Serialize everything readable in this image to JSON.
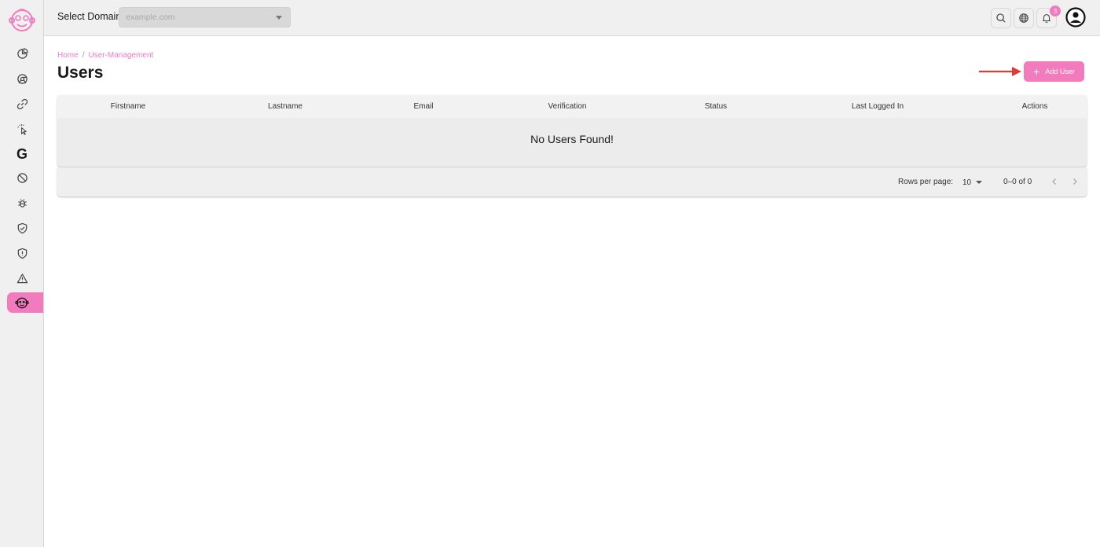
{
  "header": {
    "domain_label": "Select Domain",
    "domain_value": "example.com",
    "notification_count": "3"
  },
  "breadcrumb": {
    "home": "Home",
    "separator": "/",
    "current": "User-Management"
  },
  "page": {
    "title": "Users",
    "add_button_label": "Add User"
  },
  "table": {
    "columns": [
      "Firstname",
      "Lastname",
      "Email",
      "Verification",
      "Status",
      "Last Logged In",
      "Actions"
    ],
    "empty_message": "No Users Found!"
  },
  "pagination": {
    "rows_per_page_label": "Rows per page:",
    "rows_per_page": "10",
    "range": "0–0 of 0"
  },
  "icons": {
    "prev": "chevron-left-icon",
    "next": "chevron-right-icon"
  },
  "colors": {
    "accent": "#f27bbd",
    "annotation_arrow": "#e53935"
  }
}
